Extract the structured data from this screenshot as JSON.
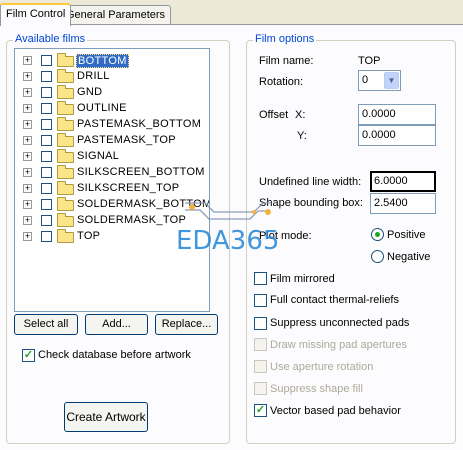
{
  "tabs": [
    {
      "label": "Film Control",
      "active": true
    },
    {
      "label": "General Parameters",
      "active": false
    }
  ],
  "available_films": {
    "title": "Available films",
    "items": [
      {
        "name": "BOTTOM",
        "selected": true
      },
      {
        "name": "DRILL"
      },
      {
        "name": "GND"
      },
      {
        "name": "OUTLINE"
      },
      {
        "name": "PASTEMASK_BOTTOM"
      },
      {
        "name": "PASTEMASK_TOP"
      },
      {
        "name": "SIGNAL"
      },
      {
        "name": "SILKSCREEN_BOTTOM"
      },
      {
        "name": "SILKSCREEN_TOP"
      },
      {
        "name": "SOLDERMASK_BOTTOM"
      },
      {
        "name": "SOLDERMASK_TOP"
      },
      {
        "name": "TOP"
      }
    ],
    "expander_glyph": "+",
    "buttons": {
      "select_all": "Select all",
      "add": "Add...",
      "replace": "Replace..."
    },
    "check_database": {
      "label": "Check database before artwork",
      "checked": true
    },
    "create_artwork": "Create Artwork"
  },
  "film_options": {
    "title": "Film options",
    "film_name_label": "Film name:",
    "film_name_value": "TOP",
    "rotation_label": "Rotation:",
    "rotation_value": "0",
    "offset_label": "Offset",
    "x_label": "X:",
    "x_value": "0.0000",
    "y_label": "Y:",
    "y_value": "0.0000",
    "undefined_line_width_label": "Undefined line width:",
    "undefined_line_width_value": "6.0000",
    "shape_bounding_box_label": "Shape bounding box:",
    "shape_bounding_box_value": "2.5400",
    "plot_mode_label": "Plot mode:",
    "plot_mode": {
      "positive": "Positive",
      "negative": "Negative",
      "selected": "positive"
    },
    "options": [
      {
        "label": "Film mirrored",
        "checked": false,
        "enabled": true
      },
      {
        "label": "Full contact thermal-reliefs",
        "checked": false,
        "enabled": true
      },
      {
        "label": "Suppress unconnected pads",
        "checked": false,
        "enabled": true
      },
      {
        "label": "Draw missing pad apertures",
        "checked": false,
        "enabled": false
      },
      {
        "label": "Use aperture rotation",
        "checked": false,
        "enabled": false
      },
      {
        "label": "Suppress shape fill",
        "checked": false,
        "enabled": false
      },
      {
        "label": "Vector based pad behavior",
        "checked": true,
        "enabled": true
      }
    ]
  },
  "watermark": "EDA365",
  "colors": {
    "accent": "#0046D5",
    "selection": "#316AC5",
    "check": "#21A121",
    "window_bg": "#ECE9D8"
  }
}
